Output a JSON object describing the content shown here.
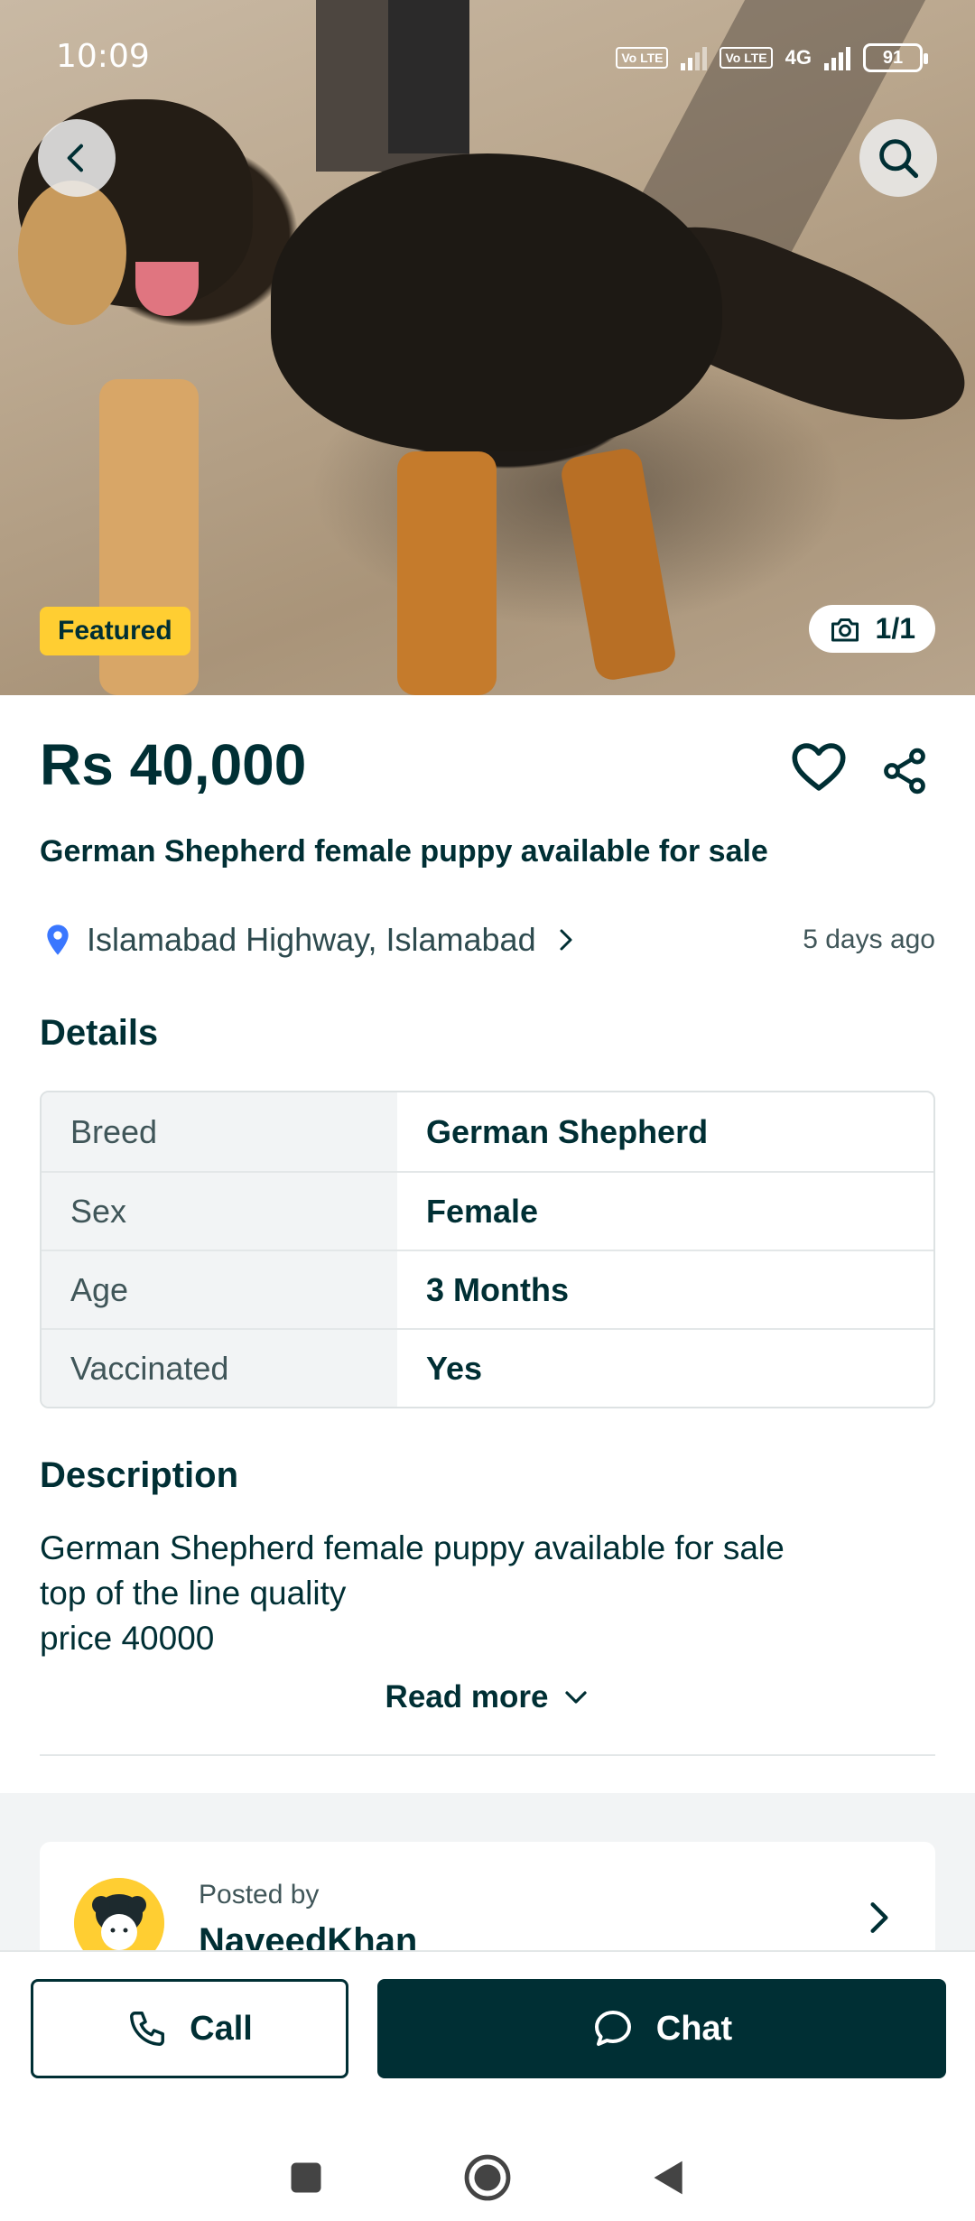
{
  "status_bar": {
    "time": "10:09",
    "sim1_badge": "Vo LTE",
    "sim2_badge": "Vo LTE",
    "network_type": "4G",
    "battery": "91"
  },
  "hero": {
    "featured_label": "Featured",
    "photo_counter": "1/1"
  },
  "listing": {
    "price": "Rs 40,000",
    "title": "German Shepherd female puppy available for sale",
    "location": "Islamabad Highway, Islamabad",
    "posted_ago": "5 days ago"
  },
  "details": {
    "heading": "Details",
    "rows": [
      {
        "key": "Breed",
        "value": "German Shepherd"
      },
      {
        "key": "Sex",
        "value": "Female"
      },
      {
        "key": "Age",
        "value": "3 Months"
      },
      {
        "key": "Vaccinated",
        "value": "Yes"
      }
    ]
  },
  "description": {
    "heading": "Description",
    "lines": [
      "German Shepherd female puppy available for sale",
      "top of the line quality",
      "price 40000"
    ],
    "read_more_label": "Read more"
  },
  "seller": {
    "posted_by_label": "Posted by",
    "name": "NaveedKhan"
  },
  "actions": {
    "call_label": "Call",
    "chat_label": "Chat"
  },
  "theme": {
    "primary": "#002f34",
    "featured_yellow": "#ffce32",
    "pin_blue": "#3a77ff"
  }
}
